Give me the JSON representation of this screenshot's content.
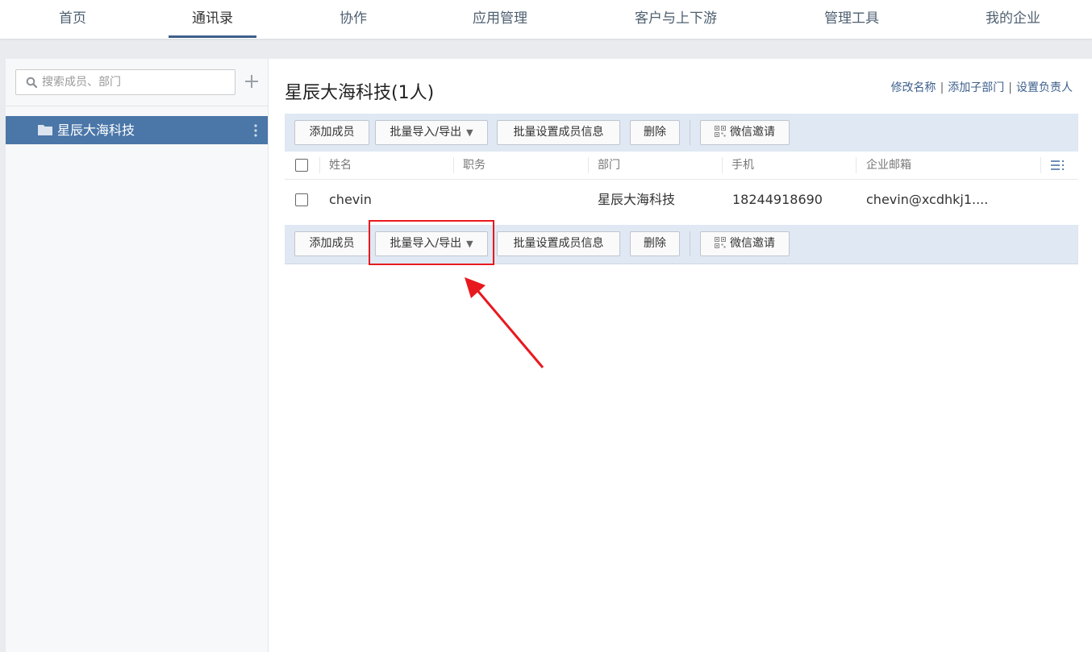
{
  "nav": {
    "items": [
      "首页",
      "通讯录",
      "协作",
      "应用管理",
      "客户与上下游",
      "管理工具",
      "我的企业"
    ],
    "active": "通讯录"
  },
  "sidebar": {
    "search_placeholder": "搜索成员、部门",
    "tree": [
      {
        "label": "星辰大海科技",
        "selected": true
      }
    ]
  },
  "main": {
    "title": "星辰大海科技(1人)",
    "header_links": [
      "修改名称",
      "添加子部门",
      "设置负责人"
    ],
    "toolbar": {
      "add_member": "添加成员",
      "bulk_import_export": "批量导入/导出",
      "bulk_set_info": "批量设置成员信息",
      "delete": "删除",
      "wechat_invite": "微信邀请"
    },
    "table": {
      "columns": [
        "姓名",
        "职务",
        "部门",
        "手机",
        "企业邮箱"
      ],
      "rows": [
        {
          "name": "chevin",
          "title": "",
          "dept": "星辰大海科技",
          "phone": "18244918690",
          "email": "chevin@xcdhkj1...."
        }
      ]
    }
  },
  "colors": {
    "accent": "#3d5f8c",
    "sidebar_selected": "#4a76a8",
    "toolbar_bg": "#dfe8f3",
    "annotation": "#e8191e"
  }
}
